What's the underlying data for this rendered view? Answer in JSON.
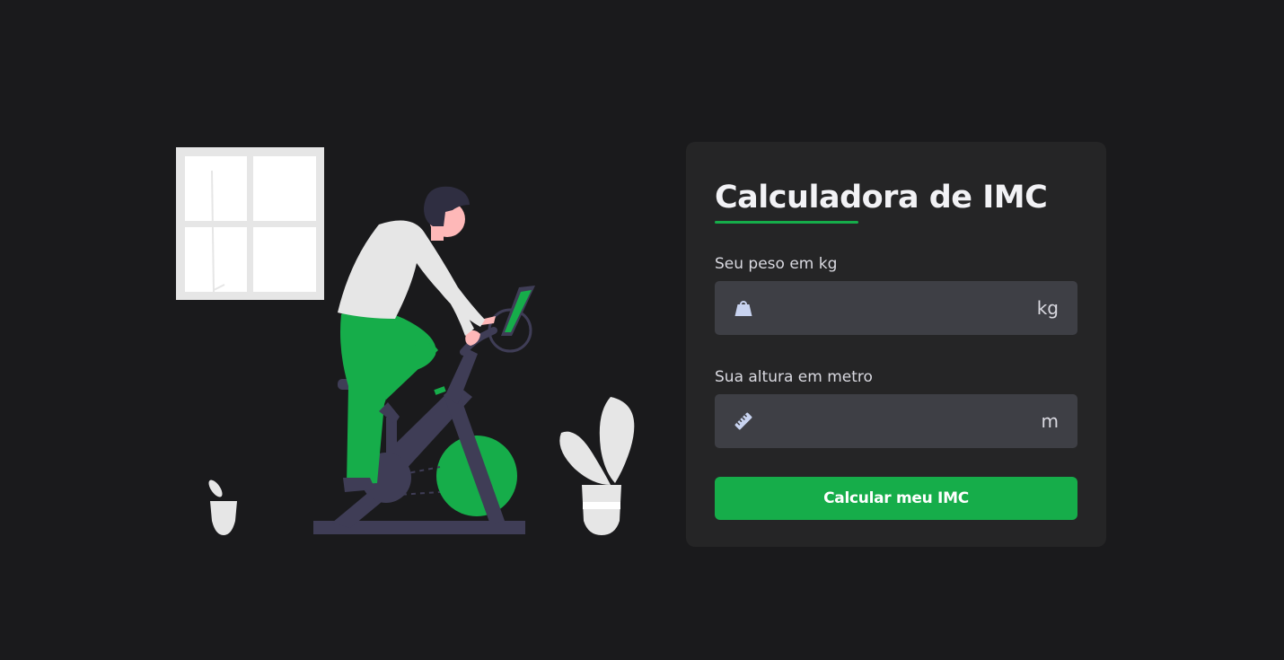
{
  "calculator": {
    "title": "Calculadora de IMC",
    "weight": {
      "label": "Seu peso em kg",
      "value": "",
      "placeholder": "",
      "unit": "kg",
      "icon": "weight-icon"
    },
    "height": {
      "label": "Sua altura em metro",
      "value": "",
      "placeholder": "",
      "unit": "m",
      "icon": "ruler-icon"
    },
    "button_label": "Calcular meu IMC"
  },
  "colors": {
    "background": "#1a1a1c",
    "card": "#252526",
    "input": "#3e3f45",
    "accent": "#16ad4a",
    "text": "#f2f2f5"
  }
}
